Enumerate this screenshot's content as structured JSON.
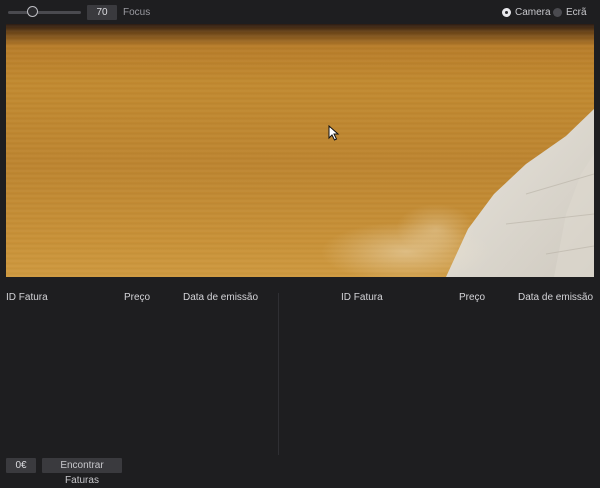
{
  "toolbar": {
    "focus_value": "70",
    "focus_label": "Focus",
    "focus_level": 0.3,
    "source_options": [
      {
        "label": "Camera",
        "selected": true
      },
      {
        "label": "Ecrã",
        "selected": false
      }
    ]
  },
  "camera": {
    "dominant_color": "#c28a30",
    "cursor_icon": "arrow-cursor-icon"
  },
  "tables": {
    "left": {
      "headers": [
        "ID Fatura",
        "Preço",
        "Data de emissão"
      ],
      "rows": []
    },
    "right": {
      "headers": [
        "ID Fatura",
        "Preço",
        "Data de emissão"
      ],
      "rows": []
    }
  },
  "footer": {
    "total": "0€",
    "find_button": "Encontrar Faturas"
  }
}
